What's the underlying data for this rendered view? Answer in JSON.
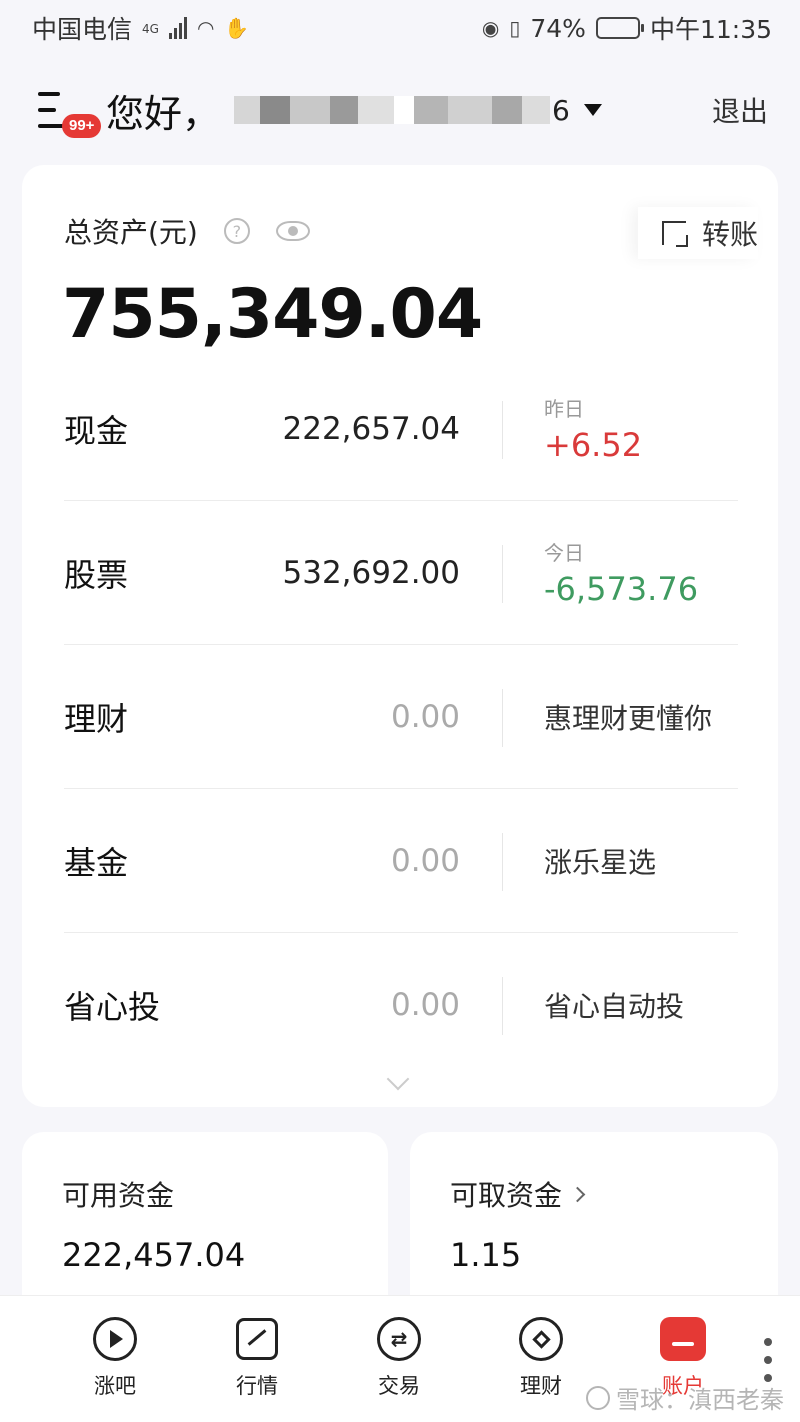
{
  "status_bar": {
    "carrier": "中国电信",
    "network": "4G",
    "battery": "74%",
    "battery_level": 0.74,
    "time": "中午11:35"
  },
  "header": {
    "menu_badge": "99+",
    "greeting": "您好，",
    "account_tail": "6",
    "logout": "退出"
  },
  "assets": {
    "total_label": "总资产(元)",
    "transfer_label": "转账",
    "total_value": "755,349.04",
    "rows": [
      {
        "name": "现金",
        "value": "222,657.04",
        "side_label": "昨日",
        "side_value": "+6.52"
      },
      {
        "name": "股票",
        "value": "532,692.00",
        "side_label": "今日",
        "side_value": "-6,573.76"
      },
      {
        "name": "理财",
        "value": "0.00",
        "side_text": "惠理财更懂你"
      },
      {
        "name": "基金",
        "value": "0.00",
        "side_text": "涨乐星选"
      },
      {
        "name": "省心投",
        "value": "0.00",
        "side_text": "省心自动投"
      }
    ]
  },
  "funds": {
    "available_label": "可用资金",
    "available_value": "222,457.04",
    "withdrawable_label": "可取资金",
    "withdrawable_value": "1.15"
  },
  "nav": {
    "items": [
      {
        "label": "涨吧",
        "icon": "play-bubble-icon"
      },
      {
        "label": "行情",
        "icon": "trend-icon"
      },
      {
        "label": "交易",
        "icon": "swap-icon"
      },
      {
        "label": "理财",
        "icon": "diamond-icon"
      },
      {
        "label": "账户",
        "icon": "account-icon"
      }
    ],
    "active": "账户"
  },
  "watermark": "雪球：滇西老秦",
  "colors": {
    "up": "#d93a3a",
    "down": "#3f9b60",
    "accent": "#e53935",
    "background": "#f6f6fa"
  }
}
